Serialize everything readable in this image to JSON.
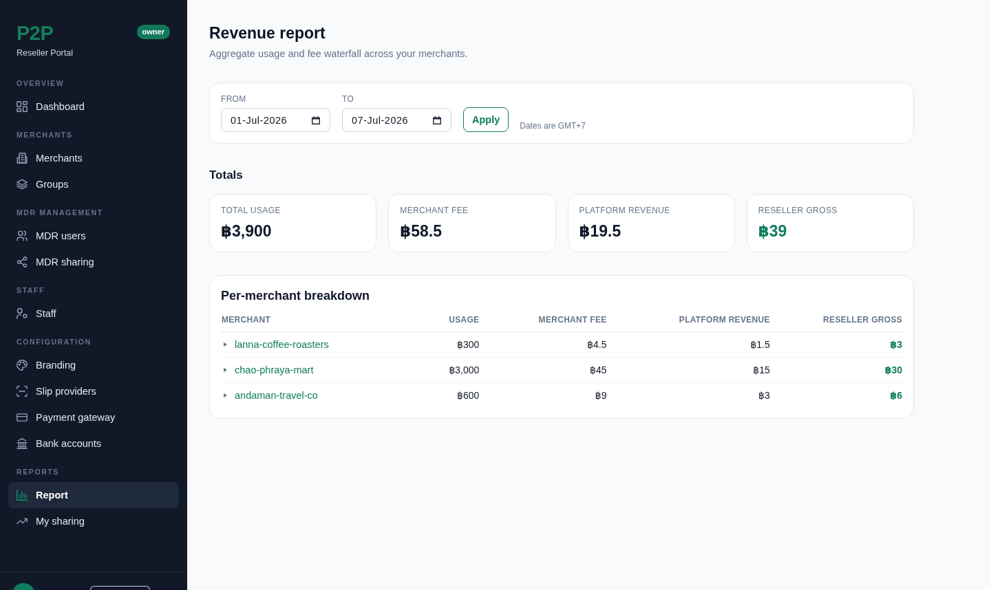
{
  "sidebar": {
    "logo": "P2P",
    "role_badge": "owner",
    "subtitle": "Reseller Portal",
    "sections": [
      {
        "heading": "OVERVIEW",
        "items": [
          {
            "label": "Dashboard",
            "selected": false
          }
        ]
      },
      {
        "heading": "MERCHANTS",
        "items": [
          {
            "label": "Merchants",
            "selected": false
          },
          {
            "label": "Groups",
            "selected": false
          }
        ]
      },
      {
        "heading": "MDR MANAGEMENT",
        "items": [
          {
            "label": "MDR users",
            "selected": false
          },
          {
            "label": "MDR sharing",
            "selected": false
          }
        ]
      },
      {
        "heading": "STAFF",
        "items": [
          {
            "label": "Staff",
            "selected": false
          }
        ]
      },
      {
        "heading": "CONFIGURATION",
        "items": [
          {
            "label": "Branding",
            "selected": false
          },
          {
            "label": "Slip providers",
            "selected": false
          },
          {
            "label": "Payment gateway",
            "selected": false
          },
          {
            "label": "Bank accounts",
            "selected": false
          }
        ]
      },
      {
        "heading": "REPORTS",
        "items": [
          {
            "label": "Report",
            "selected": true
          },
          {
            "label": "My sharing",
            "selected": false
          }
        ]
      }
    ]
  },
  "page": {
    "title": "Revenue report",
    "subtitle": "Aggregate usage and fee waterfall across your merchants."
  },
  "filters": {
    "from": {
      "label": "FROM",
      "value": "01-Jul-2026"
    },
    "to": {
      "label": "TO",
      "value": "07-Jul-2026"
    },
    "apply_button": "Apply",
    "timezone_note": "Dates are GMT+7"
  },
  "totals": {
    "heading": "Totals",
    "cards": [
      {
        "label": "TOTAL USAGE",
        "value": "฿3,900",
        "highlighted": false
      },
      {
        "label": "MERCHANT FEE",
        "value": "฿58.5",
        "highlighted": false
      },
      {
        "label": "PLATFORM REVENUE",
        "value": "฿19.5",
        "highlighted": false
      },
      {
        "label": "RESELLER GROSS",
        "value": "฿39",
        "highlighted": true
      }
    ]
  },
  "breakdown": {
    "title": "Per-merchant breakdown",
    "columns": [
      {
        "label": "MERCHANT",
        "kind": "link"
      },
      {
        "label": "USAGE",
        "kind": "amount"
      },
      {
        "label": "MERCHANT FEE",
        "kind": "amount"
      },
      {
        "label": "PLATFORM REVENUE",
        "kind": "amount"
      },
      {
        "label": "RESELLER GROSS",
        "kind": "gross"
      }
    ],
    "rows": [
      {
        "expanded": false,
        "cells": [
          "lanna-coffee-roasters",
          "฿300",
          "฿4.5",
          "฿1.5",
          "฿3"
        ]
      },
      {
        "expanded": false,
        "cells": [
          "chao-phraya-mart",
          "฿3,000",
          "฿45",
          "฿15",
          "฿30"
        ]
      },
      {
        "expanded": false,
        "cells": [
          "andaman-travel-co",
          "฿600",
          "฿9",
          "฿3",
          "฿6"
        ]
      }
    ]
  }
}
